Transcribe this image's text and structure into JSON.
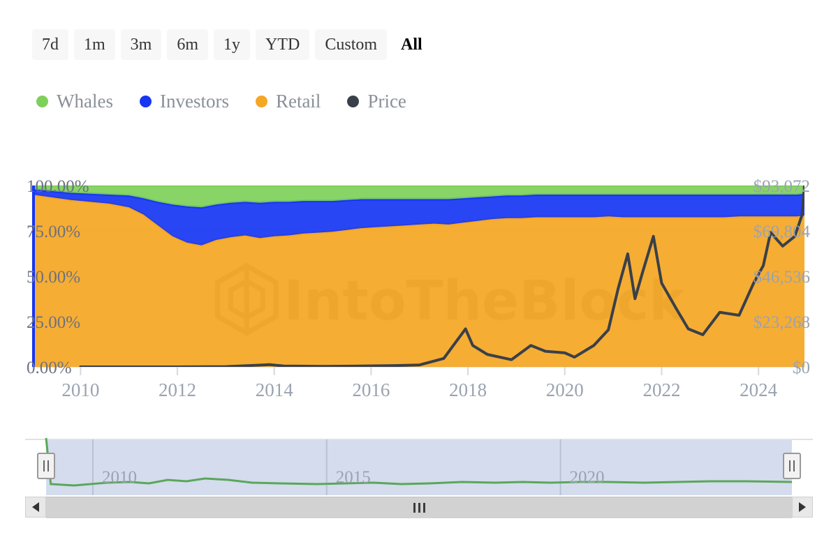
{
  "range_selector": {
    "buttons": [
      {
        "label": "7d",
        "selected": false
      },
      {
        "label": "1m",
        "selected": false
      },
      {
        "label": "3m",
        "selected": false
      },
      {
        "label": "6m",
        "selected": false
      },
      {
        "label": "1y",
        "selected": false
      },
      {
        "label": "YTD",
        "selected": false
      },
      {
        "label": "Custom",
        "selected": false
      },
      {
        "label": "All",
        "selected": true
      }
    ]
  },
  "legend": {
    "items": [
      {
        "label": "Whales",
        "color": "#7ed05a",
        "icon": "legend-dot-icon"
      },
      {
        "label": "Investors",
        "color": "#1636f2",
        "icon": "legend-dot-icon"
      },
      {
        "label": "Retail",
        "color": "#f5a623",
        "icon": "legend-dot-icon"
      },
      {
        "label": "Price",
        "color": "#3a4049",
        "icon": "legend-dot-icon"
      }
    ]
  },
  "watermark": {
    "text": "IntoTheBlock",
    "logo": "hexagon-logo-icon"
  },
  "navigator": {
    "year_labels": [
      "2010",
      "2015",
      "2020"
    ],
    "series_color": "#5aa75a",
    "selection_fill": "#ccd6ea",
    "left_handle": "navigator-left-handle",
    "right_handle": "navigator-right-handle"
  },
  "scrollbar": {
    "left_arrow": "scroll-left-arrow-icon",
    "right_arrow": "scroll-right-arrow-icon",
    "grip": "scrollbar-grip-icon"
  },
  "chart_data": {
    "type": "area",
    "title": "",
    "subtitle": "",
    "xlabel": "",
    "ylabel": "",
    "stacked": true,
    "stack_mode": "percent",
    "grid": true,
    "legend_position": "top-left",
    "xlim": [
      2009.0,
      2024.95
    ],
    "x_tick_labels": [
      "2010",
      "2012",
      "2014",
      "2016",
      "2018",
      "2020",
      "2022",
      "2024"
    ],
    "x_tick_values": [
      2010,
      2012,
      2014,
      2016,
      2018,
      2020,
      2022,
      2024
    ],
    "left_axis": {
      "label": "",
      "ylim": [
        0,
        100
      ],
      "tick_labels": [
        "0.00%",
        "25.00%",
        "50.00%",
        "75.00%",
        "100.00%"
      ],
      "tick_values": [
        0,
        25,
        50,
        75,
        100
      ],
      "units": "percent"
    },
    "right_axis": {
      "label": "",
      "ylim": [
        0,
        93072
      ],
      "tick_labels": [
        "$0",
        "$23,268",
        "$46,536",
        "$69,804",
        "$93,072"
      ],
      "tick_values": [
        0,
        23268,
        46536,
        69804,
        93072
      ],
      "units": "usd"
    },
    "x": [
      2009.0,
      2009.4,
      2009.8,
      2010.2,
      2010.6,
      2011.0,
      2011.3,
      2011.6,
      2011.9,
      2012.2,
      2012.5,
      2012.8,
      2013.1,
      2013.4,
      2013.7,
      2014.0,
      2014.3,
      2014.6,
      2014.9,
      2015.2,
      2015.5,
      2015.8,
      2016.1,
      2016.4,
      2016.7,
      2017.0,
      2017.3,
      2017.6,
      2017.9,
      2018.2,
      2018.5,
      2018.8,
      2019.1,
      2019.4,
      2019.7,
      2020.0,
      2020.3,
      2020.6,
      2020.9,
      2021.2,
      2021.5,
      2021.8,
      2022.1,
      2022.4,
      2022.7,
      2023.0,
      2023.3,
      2023.6,
      2023.9,
      2024.2,
      2024.5,
      2024.8,
      2024.95
    ],
    "series": [
      {
        "name": "Retail",
        "color": "#f5a623",
        "values": [
          95.0,
          93.5,
          92.0,
          91.0,
          90.0,
          88.0,
          84.0,
          78.0,
          72.0,
          68.5,
          67.0,
          70.0,
          71.5,
          72.5,
          71.0,
          72.0,
          72.5,
          73.5,
          74.0,
          74.5,
          75.5,
          76.5,
          77.0,
          77.5,
          78.0,
          78.5,
          79.0,
          78.5,
          79.5,
          80.5,
          81.5,
          82.0,
          82.0,
          82.5,
          82.5,
          82.5,
          82.5,
          82.5,
          83.0,
          82.5,
          82.5,
          82.5,
          82.5,
          82.5,
          82.5,
          82.5,
          82.5,
          83.0,
          83.0,
          83.0,
          83.0,
          83.0,
          83.5
        ]
      },
      {
        "name": "Investors",
        "color": "#1636f2",
        "values": [
          3.0,
          3.5,
          4.0,
          4.5,
          5.0,
          6.5,
          9.0,
          13.0,
          17.5,
          20.0,
          21.0,
          19.5,
          19.0,
          18.5,
          19.5,
          19.0,
          18.5,
          18.0,
          17.5,
          17.0,
          16.5,
          16.0,
          15.5,
          15.0,
          14.5,
          14.0,
          13.5,
          14.0,
          13.5,
          13.0,
          12.5,
          12.5,
          12.5,
          12.5,
          12.5,
          12.5,
          12.5,
          12.5,
          12.0,
          12.5,
          12.5,
          12.5,
          12.5,
          12.5,
          12.5,
          12.5,
          12.5,
          12.0,
          12.0,
          12.0,
          12.0,
          12.0,
          12.0
        ]
      },
      {
        "name": "Whales",
        "color": "#7ed05a",
        "values": [
          2.0,
          3.0,
          4.0,
          4.5,
          5.0,
          5.5,
          7.0,
          9.0,
          10.5,
          11.5,
          12.0,
          10.5,
          9.5,
          9.0,
          9.5,
          9.0,
          9.0,
          8.5,
          8.5,
          8.5,
          8.0,
          7.5,
          7.5,
          7.5,
          7.5,
          7.5,
          7.5,
          7.5,
          7.0,
          6.5,
          6.0,
          5.5,
          5.5,
          5.0,
          5.0,
          5.0,
          5.0,
          5.0,
          5.0,
          5.0,
          5.0,
          5.0,
          5.0,
          5.0,
          5.0,
          5.0,
          5.0,
          5.0,
          5.0,
          5.0,
          5.0,
          5.0,
          4.5
        ]
      }
    ],
    "price_series": {
      "name": "Price",
      "color": "#3a4049",
      "axis": "right",
      "units": "usd",
      "x": [
        2010.0,
        2011.0,
        2011.5,
        2012.0,
        2013.0,
        2013.9,
        2014.2,
        2015.0,
        2015.8,
        2016.5,
        2017.0,
        2017.5,
        2017.95,
        2018.1,
        2018.4,
        2018.9,
        2019.3,
        2019.6,
        2020.0,
        2020.2,
        2020.6,
        2020.9,
        2021.1,
        2021.3,
        2021.45,
        2021.6,
        2021.83,
        2022.0,
        2022.3,
        2022.55,
        2022.85,
        2023.2,
        2023.6,
        2023.9,
        2024.1,
        2024.25,
        2024.5,
        2024.75,
        2024.9,
        2024.95
      ],
      "values": [
        0,
        2,
        15,
        5,
        130,
        1150,
        450,
        250,
        430,
        650,
        1000,
        4300,
        19500,
        11000,
        6400,
        3700,
        11000,
        8000,
        7200,
        5000,
        11000,
        19000,
        40000,
        58000,
        35000,
        48000,
        67000,
        43000,
        30000,
        19500,
        16500,
        28000,
        26500,
        43000,
        52000,
        69000,
        62000,
        67000,
        78000,
        93000
      ]
    }
  }
}
